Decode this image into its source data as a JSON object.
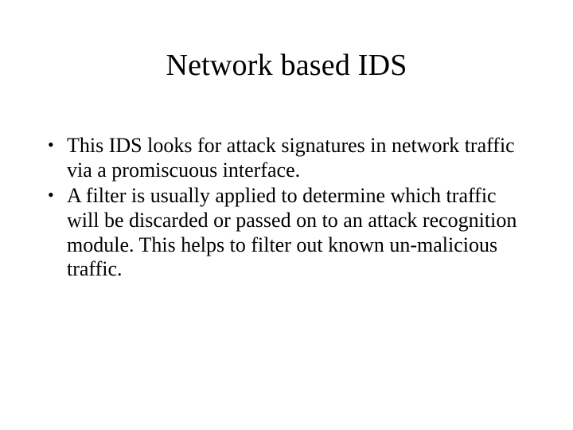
{
  "slide": {
    "title": "Network based IDS",
    "bullets": [
      "This IDS looks for attack signatures in network traffic via a promiscuous interface.",
      "A filter is usually applied to determine which traffic will be discarded or passed on to an attack recognition module. This helps to filter out known un-malicious traffic."
    ]
  }
}
